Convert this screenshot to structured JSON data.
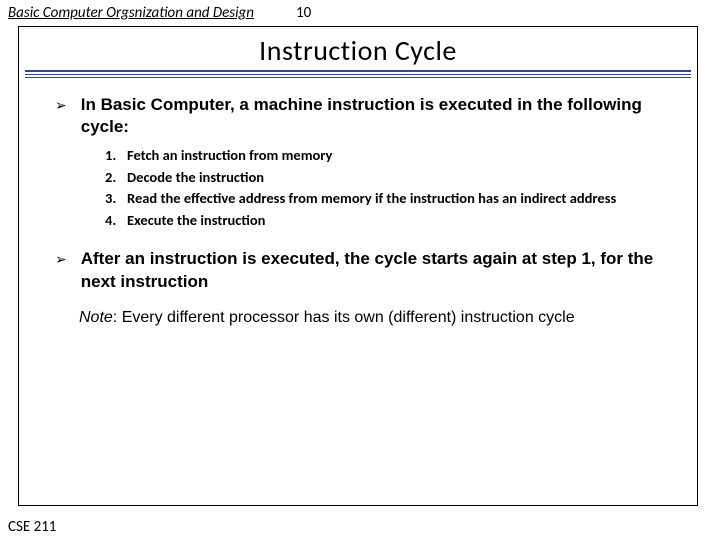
{
  "header": {
    "topic": "Basic Computer Orgsnization and Design",
    "page_number": "10"
  },
  "slide": {
    "title": "Instruction Cycle",
    "bullets": [
      {
        "text": "In Basic Computer, a machine instruction is executed in the following cycle:",
        "steps": [
          "Fetch an instruction from memory",
          "Decode the instruction",
          "Read the effective address from memory if the instruction has an indirect address",
          "Execute the instruction"
        ]
      },
      {
        "text": "After an instruction is executed, the cycle starts again at step 1, for the next instruction",
        "steps": []
      }
    ],
    "note_label": "Note",
    "note_text": ": Every different processor has its own (different) instruction cycle"
  },
  "footer": {
    "course": "CSE 211"
  }
}
